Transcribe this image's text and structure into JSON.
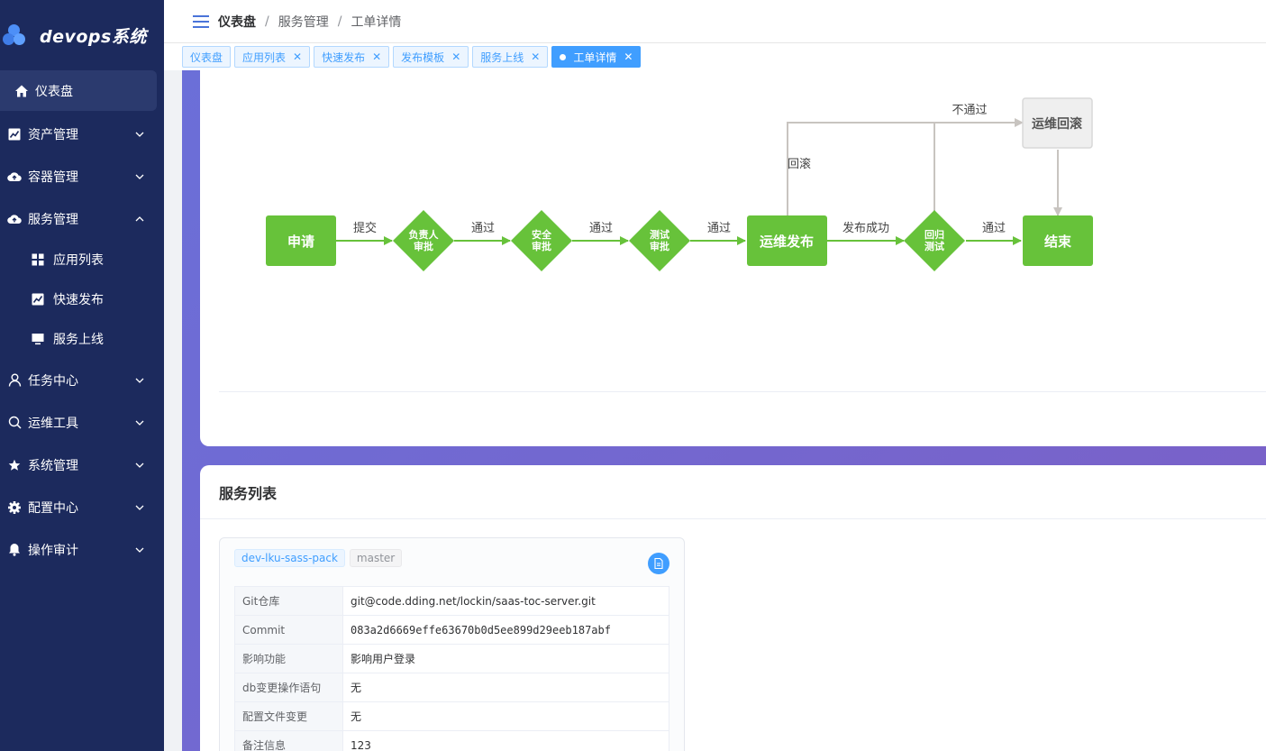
{
  "app": {
    "title": "devops系统"
  },
  "sidebar": {
    "items": [
      {
        "label": "仪表盘",
        "icon": "home-icon",
        "active": true
      },
      {
        "label": "资产管理",
        "icon": "chart-icon",
        "expandable": true
      },
      {
        "label": "容器管理",
        "icon": "cloud-upload-icon",
        "expandable": true
      },
      {
        "label": "服务管理",
        "icon": "cloud-upload-icon",
        "expandable": true,
        "expanded": true
      },
      {
        "label": "任务中心",
        "icon": "user-icon",
        "expandable": true
      },
      {
        "label": "运维工具",
        "icon": "search-icon",
        "expandable": true
      },
      {
        "label": "系统管理",
        "icon": "star-icon",
        "expandable": true
      },
      {
        "label": "配置中心",
        "icon": "gear-icon",
        "expandable": true
      },
      {
        "label": "操作审计",
        "icon": "bell-icon",
        "expandable": true
      }
    ],
    "submenu": [
      {
        "label": "应用列表",
        "icon": "grid-icon"
      },
      {
        "label": "快速发布",
        "icon": "chart-icon"
      },
      {
        "label": "服务上线",
        "icon": "monitor-icon"
      }
    ]
  },
  "breadcrumb": [
    "仪表盘",
    "服务管理",
    "工单详情"
  ],
  "tabs": [
    {
      "label": "仪表盘",
      "closable": false
    },
    {
      "label": "应用列表",
      "closable": true
    },
    {
      "label": "快速发布",
      "closable": true
    },
    {
      "label": "发布模板",
      "closable": true
    },
    {
      "label": "服务上线",
      "closable": true
    },
    {
      "label": "工单详情",
      "closable": true,
      "active": true
    }
  ],
  "flow": {
    "nodes": {
      "apply": "申请",
      "owner_approve_1": "负责人",
      "owner_approve_2": "审批",
      "security_1": "安全",
      "security_2": "审批",
      "test_1": "测试",
      "test_2": "审批",
      "deploy": "运维发布",
      "regression_1": "回归",
      "regression_2": "测试",
      "end": "结束",
      "rollback": "运维回滚"
    },
    "edges": {
      "submit": "提交",
      "pass1": "通过",
      "pass2": "通过",
      "pass3": "通过",
      "deploy_success": "发布成功",
      "pass4": "通过",
      "rollback_label": "回滚",
      "reject": "不通过"
    },
    "colors": {
      "active": "#67c23a",
      "inactive_bg": "#efefef",
      "inactive_border": "#d8d8d8",
      "line_gray": "#c8c4c0"
    }
  },
  "services": {
    "title": "服务列表",
    "card": {
      "branch_name": "dev-lku-sass-pack",
      "branch": "master",
      "rows": [
        {
          "key": "Git仓库",
          "value": "git@code.dding.net/lockin/saas-toc-server.git"
        },
        {
          "key": "Commit",
          "value": "083a2d6669effe63670b0d5ee899d29eeb187abf"
        },
        {
          "key": "影响功能",
          "value": "影响用户登录"
        },
        {
          "key": "db变更操作语句",
          "value": "无"
        },
        {
          "key": "配置文件变更",
          "value": "无"
        },
        {
          "key": "备注信息",
          "value": "123"
        }
      ]
    }
  }
}
